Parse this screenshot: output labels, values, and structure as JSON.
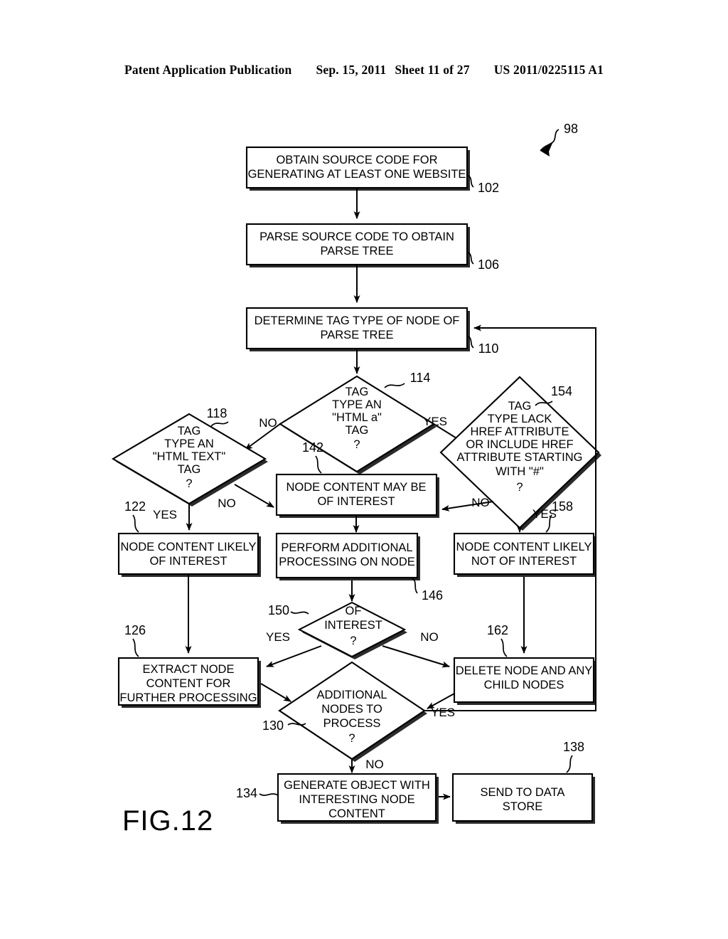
{
  "header": {
    "publication": "Patent Application Publication",
    "date": "Sep. 15, 2011",
    "sheet": "Sheet 11 of 27",
    "number": "US 2011/0225115 A1"
  },
  "figure": {
    "label": "FIG.12",
    "diagram_ref": "98"
  },
  "nodes": {
    "n102": {
      "ref": "102",
      "line1": "OBTAIN SOURCE CODE FOR",
      "line2": "GENERATING AT LEAST ONE WEBSITE"
    },
    "n106": {
      "ref": "106",
      "line1": "PARSE SOURCE CODE TO OBTAIN",
      "line2": "PARSE TREE"
    },
    "n110": {
      "ref": "110",
      "line1": "DETERMINE TAG TYPE OF NODE OF",
      "line2": "PARSE TREE"
    },
    "n114": {
      "ref": "114",
      "line1": "TAG",
      "line2": "TYPE AN",
      "line3": "\"HTML a\"",
      "line4": "TAG",
      "line5": "?"
    },
    "n118": {
      "ref": "118",
      "line1": "TAG",
      "line2": "TYPE AN",
      "line3": "\"HTML TEXT\"",
      "line4": "TAG",
      "line5": "?"
    },
    "n154": {
      "ref": "154",
      "line1": "TAG",
      "line2": "TYPE LACK",
      "line3": "HREF ATTRIBUTE",
      "line4": "OR INCLUDE HREF",
      "line5": "ATTRIBUTE STARTING",
      "line6": "WITH \"#\"",
      "line7": "?"
    },
    "n142": {
      "ref": "142",
      "line1": "NODE CONTENT MAY BE",
      "line2": "OF INTEREST"
    },
    "n122": {
      "ref": "122",
      "line1": "NODE CONTENT LIKELY",
      "line2": "OF INTEREST"
    },
    "n146": {
      "ref": "146",
      "line1": "PERFORM ADDITIONAL",
      "line2": "PROCESSING ON NODE"
    },
    "n158": {
      "ref": "158",
      "line1": "NODE CONTENT LIKELY",
      "line2": "NOT OF INTEREST"
    },
    "n150": {
      "ref": "150",
      "line1": "OF",
      "line2": "INTEREST",
      "line3": "?"
    },
    "n126": {
      "ref": "126",
      "line1": "EXTRACT NODE",
      "line2": "CONTENT FOR",
      "line3": "FURTHER PROCESSING"
    },
    "n162": {
      "ref": "162",
      "line1": "DELETE NODE AND ANY",
      "line2": "CHILD NODES"
    },
    "n130": {
      "ref": "130",
      "line1": "ADDITIONAL",
      "line2": "NODES TO",
      "line3": "PROCESS",
      "line4": "?"
    },
    "n134": {
      "ref": "134",
      "line1": "GENERATE OBJECT WITH",
      "line2": "INTERESTING NODE",
      "line3": "CONTENT"
    },
    "n138": {
      "ref": "138",
      "line1": "SEND TO DATA",
      "line2": "STORE"
    }
  },
  "edge_labels": {
    "e114_no": "NO",
    "e114_yes": "YES",
    "e118_yes": "YES",
    "e118_no": "NO",
    "e154_no": "NO",
    "e154_yes": "YES",
    "e150_yes": "YES",
    "e150_no": "NO",
    "e130_yes": "YES",
    "e130_no": "NO"
  }
}
